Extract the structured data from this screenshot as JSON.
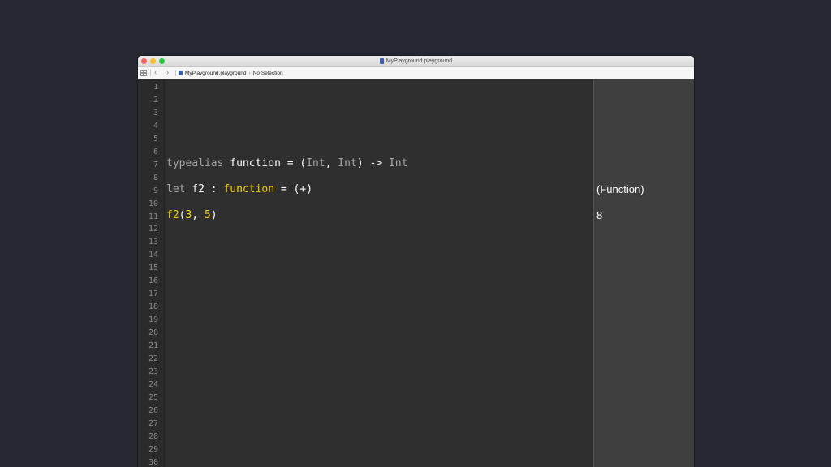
{
  "window": {
    "title": "MyPlayground.playground"
  },
  "toolbar": {
    "back_glyph": "‹",
    "forward_glyph": "›",
    "breadcrumb_file": "MyPlayground.playground",
    "breadcrumb_chevron": "›",
    "breadcrumb_selection": "No Selection"
  },
  "line_numbers": [
    "1",
    "2",
    "3",
    "4",
    "5",
    "6",
    "7",
    "8",
    "9",
    "10",
    "11",
    "12",
    "13",
    "14",
    "15",
    "16",
    "17",
    "18",
    "19",
    "20",
    "21",
    "22",
    "23",
    "24",
    "25",
    "26",
    "27",
    "28",
    "29",
    "30"
  ],
  "code": {
    "line7": {
      "t1": "typealias",
      "t2": " ",
      "t3": "function",
      "t4": " = (",
      "t5": "Int",
      "t6": ", ",
      "t7": "Int",
      "t8": ") -> ",
      "t9": "Int"
    },
    "line9": {
      "t1": "let",
      "t2": " ",
      "t3": "f2",
      "t4": " : ",
      "t5": "function",
      "t6": " = (+)"
    },
    "line11": {
      "t1": "f2",
      "t2": "(",
      "t3": "3",
      "t4": ", ",
      "t5": "5",
      "t6": ")"
    }
  },
  "results": {
    "line9": "(Function)",
    "line11": "8"
  },
  "colors": {
    "background": "#252831",
    "editor": "#2f2f2f",
    "keyword": "#a7a7a7",
    "function_yellow": "#f4d000"
  },
  "icons": [
    "grid-icon",
    "back-arrow-icon",
    "forward-arrow-icon",
    "playground-file-icon"
  ]
}
